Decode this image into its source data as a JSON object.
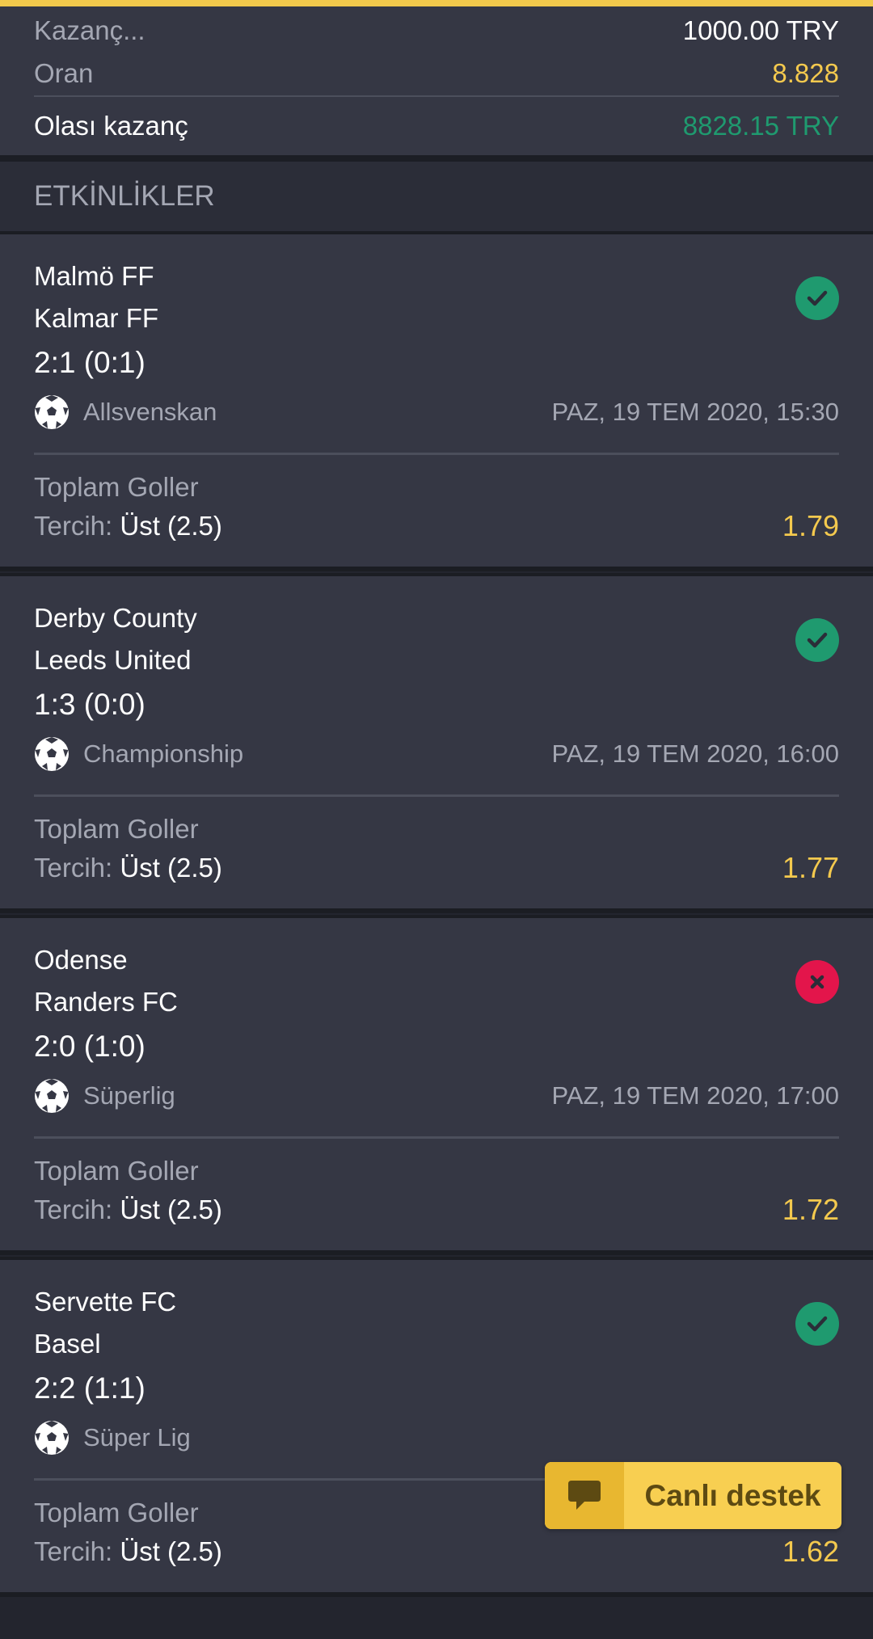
{
  "summary": {
    "stake_label": "Kazanç...",
    "stake_value": "1000.00 TRY",
    "odds_label": "Oran",
    "odds_value": "8.828",
    "potential_label": "Olası kazanç",
    "potential_value": "8828.15 TRY"
  },
  "section": {
    "title": "ETKİNLİKLER"
  },
  "events": [
    {
      "home": "Malmö FF",
      "away": "Kalmar FF",
      "score": "2:1 (0:1)",
      "league": "Allsvenskan",
      "date": "PAZ, 19 TEM 2020, 15:30",
      "market": "Toplam Goller",
      "pref_label": "Tercih:",
      "pref_value": "Üst (2.5)",
      "odds": "1.79",
      "status": "win"
    },
    {
      "home": "Derby County",
      "away": "Leeds United",
      "score": "1:3 (0:0)",
      "league": "Championship",
      "date": "PAZ, 19 TEM 2020, 16:00",
      "market": "Toplam Goller",
      "pref_label": "Tercih:",
      "pref_value": "Üst (2.5)",
      "odds": "1.77",
      "status": "win"
    },
    {
      "home": "Odense",
      "away": "Randers FC",
      "score": "2:0 (1:0)",
      "league": "Süperlig",
      "date": "PAZ, 19 TEM 2020, 17:00",
      "market": "Toplam Goller",
      "pref_label": "Tercih:",
      "pref_value": "Üst (2.5)",
      "odds": "1.72",
      "status": "lose"
    },
    {
      "home": "Servette FC",
      "away": "Basel",
      "score": "2:2 (1:1)",
      "league": "Süper Lig",
      "date": "",
      "market": "Toplam Goller",
      "pref_label": "Tercih:",
      "pref_value": "Üst (2.5)",
      "odds": "1.62",
      "status": "win"
    }
  ],
  "support": {
    "label": "Canlı destek",
    "icon": "chat-bubble-icon"
  },
  "colors": {
    "accent": "#f4c94e",
    "win": "#1f9a6f",
    "lose": "#e3154b"
  }
}
